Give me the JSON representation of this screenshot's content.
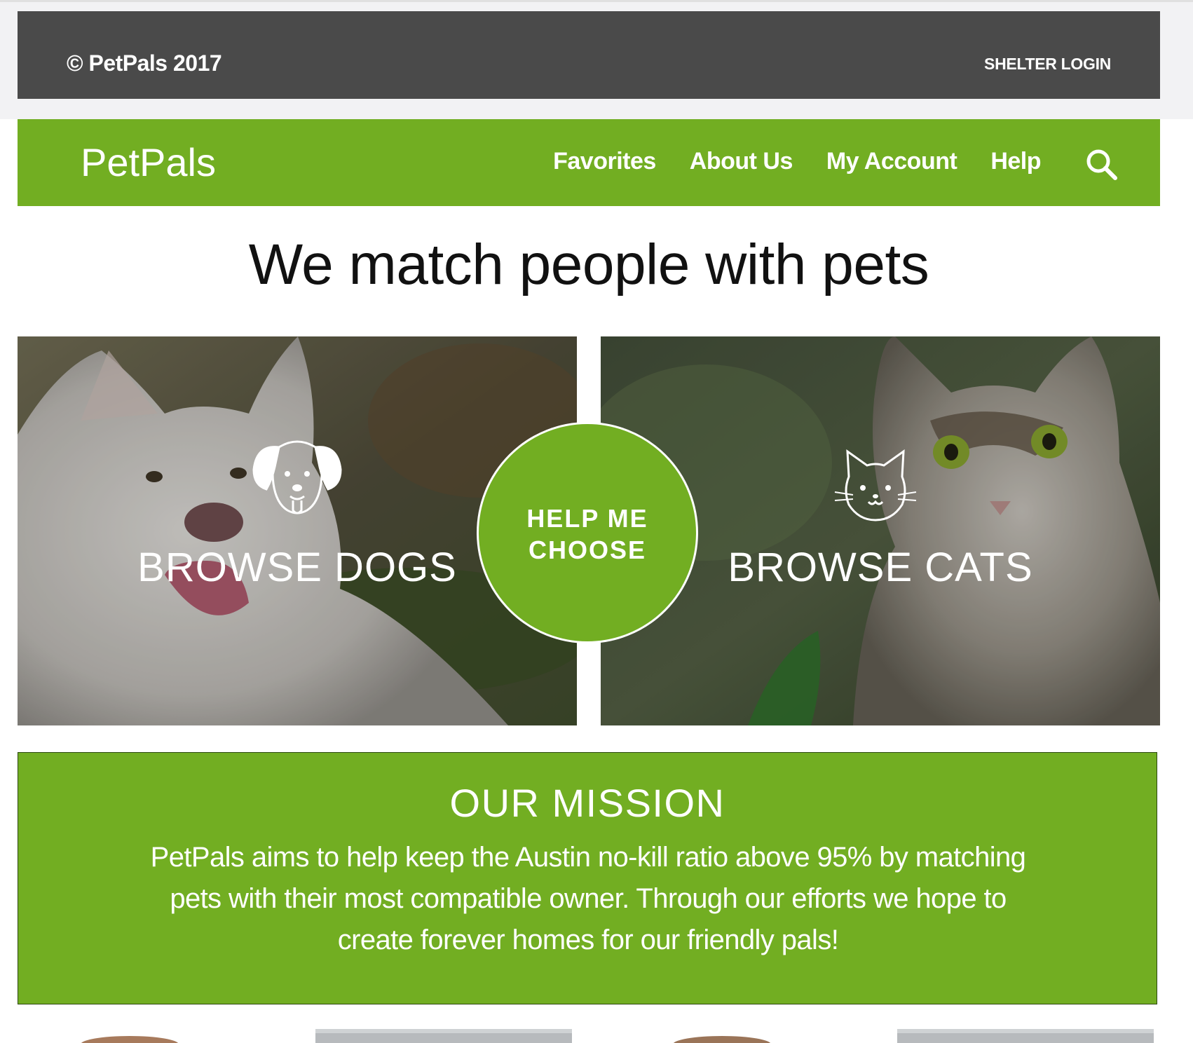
{
  "top_bar": {
    "copyright": "© PetPals 2017",
    "shelter_login": "SHELTER LOGIN"
  },
  "nav": {
    "logo": "PetPals",
    "links": [
      "Favorites",
      "About Us",
      "My Account",
      "Help"
    ],
    "search_icon": "search-icon"
  },
  "hero": {
    "title": "We match people with pets"
  },
  "browse": {
    "dogs_label": "BROWSE DOGS",
    "cats_label": "BROWSE CATS",
    "dog_icon": "dog-face-icon",
    "cat_icon": "cat-face-icon"
  },
  "help_choose": {
    "line1": "HELP ME",
    "line2": "CHOOSE"
  },
  "mission": {
    "title": "OUR MISSION",
    "text": "PetPals aims to help keep the Austin no-kill ratio above 95% by matching pets with their most compatible owner. Through our efforts we hope to create forever homes for our friendly pals!"
  },
  "colors": {
    "brand_green": "#72ae22",
    "top_bar_gray": "#4a4a4a",
    "page_background": "#ffffff"
  }
}
